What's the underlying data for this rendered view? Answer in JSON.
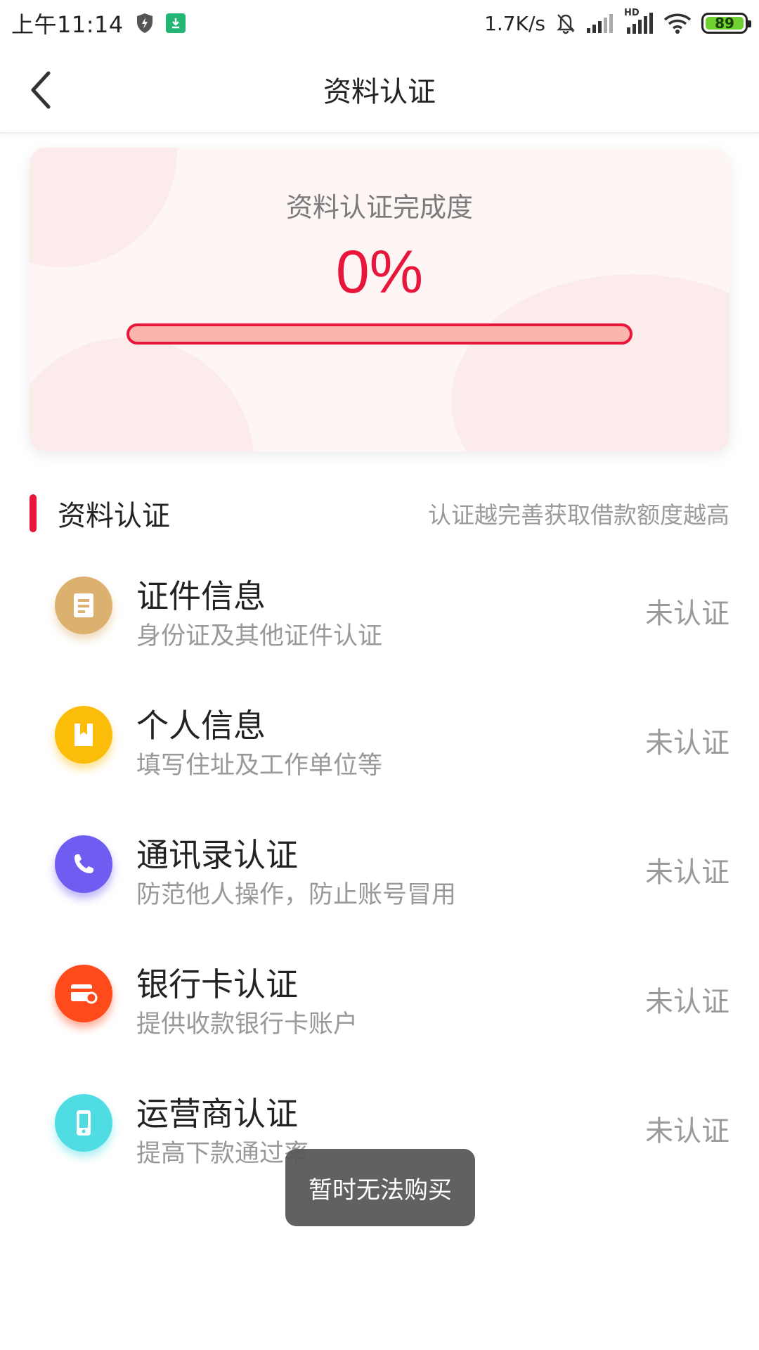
{
  "status_bar": {
    "time": "上午11:14",
    "net_speed": "1.7K/s",
    "battery": "89",
    "network_label": "HD",
    "icons": [
      "shield-icon",
      "download-icon",
      "mute-bell-icon",
      "signal-icon",
      "hd-signal-icon",
      "wifi-icon",
      "battery-icon"
    ]
  },
  "header": {
    "title": "资料认证",
    "back_icon": "chevron-left-icon"
  },
  "card": {
    "label": "资料认证完成度",
    "percent_text": "0%",
    "progress": 0,
    "accent_color": "#e8163a",
    "track_color": "#f9b4ae"
  },
  "section": {
    "title": "资料认证",
    "hint": "认证越完善获取借款额度越高"
  },
  "items": [
    {
      "title": "证件信息",
      "subtitle": "身份证及其他证件认证",
      "status": "未认证",
      "icon": "id-card-icon",
      "color": "#dcb06e"
    },
    {
      "title": "个人信息",
      "subtitle": "填写住址及工作单位等",
      "status": "未认证",
      "icon": "bookmark-icon",
      "color": "#fbbd0a"
    },
    {
      "title": "通讯录认证",
      "subtitle": "防范他人操作，防止账号冒用",
      "status": "未认证",
      "icon": "phone-icon",
      "color": "#6f5cf0"
    },
    {
      "title": "银行卡认证",
      "subtitle": "提供收款银行卡账户",
      "status": "未认证",
      "icon": "bank-card-icon",
      "color": "#ff4a1c"
    },
    {
      "title": "运营商认证",
      "subtitle": "提高下款通过率",
      "status": "未认证",
      "icon": "mobile-icon",
      "color": "#4fdde3"
    }
  ],
  "toast": {
    "text": "暂时无法购买"
  }
}
